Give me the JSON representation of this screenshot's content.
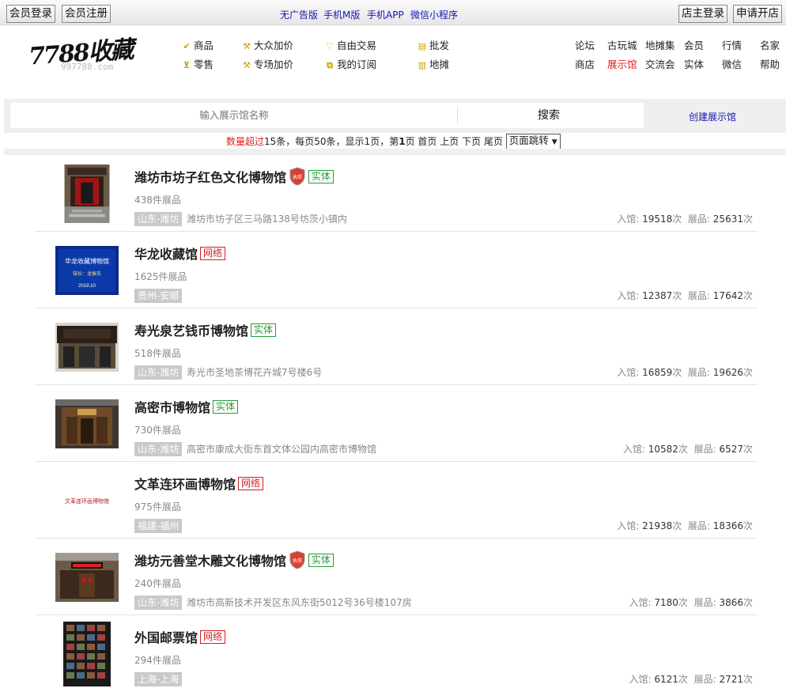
{
  "topbar": {
    "login": "会员登录",
    "register": "会员注册",
    "links": [
      "无广告版",
      "手机M版",
      "手机APP",
      "微信小程序"
    ],
    "shop_login": "店主登录",
    "open_shop": "申请开店"
  },
  "logo": {
    "main": "7788收藏",
    "sub": "997788.com"
  },
  "nav": {
    "categories": [
      {
        "icon": "check-coin",
        "label": "商品"
      },
      {
        "icon": "hammer",
        "label": "大众加价"
      },
      {
        "icon": "heart-hands",
        "label": "自由交易"
      },
      {
        "icon": "box",
        "label": "批发"
      },
      {
        "icon": "cart",
        "label": "零售"
      },
      {
        "icon": "hammer-2",
        "label": "专场加价"
      },
      {
        "icon": "bookmark",
        "label": "我的订阅"
      },
      {
        "icon": "grid",
        "label": "地摊"
      }
    ],
    "right_links_row1": [
      "论坛",
      "古玩城",
      "地摊集",
      "会员",
      "行情",
      "名家"
    ],
    "right_links_row2": [
      "商店",
      "展示馆",
      "交流会",
      "实体",
      "微信",
      "帮助"
    ],
    "active": "展示馆"
  },
  "search": {
    "placeholder": "输入展示馆名称",
    "button": "搜索",
    "create": "创建展示馆"
  },
  "pager": {
    "prefix": "数量超过",
    "total_text": "15条，每页50条，显示1页，第",
    "current": "1",
    "page_unit": "页",
    "first": "首页",
    "prev": "上页",
    "next": "下页",
    "last": "尾页",
    "jump": "页面跳转"
  },
  "items": [
    {
      "title": "潍坊市坊子红色文化博物馆",
      "badge": true,
      "tag": "实体",
      "tag_color": "green",
      "count": "438件展品",
      "region": "山东-潍坊",
      "address": "潍坊市坊子区三马路138号坊茨小镇内",
      "visits_label": "入馆:",
      "visits": "19518",
      "visits_unit": "次",
      "exhibits_label": "展品:",
      "exhibits": "25631",
      "exhibits_unit": "次"
    },
    {
      "title": "华龙收藏馆",
      "badge": false,
      "tag": "网络",
      "tag_color": "red",
      "count": "1625件展品",
      "region": "贵州-安顺",
      "address": "",
      "visits_label": "入馆:",
      "visits": "12387",
      "visits_unit": "次",
      "exhibits_label": "展品:",
      "exhibits": "17642",
      "exhibits_unit": "次"
    },
    {
      "title": "寿光泉艺钱币博物馆",
      "badge": false,
      "tag": "实体",
      "tag_color": "green",
      "count": "518件展品",
      "region": "山东-潍坊",
      "address": "寿光市圣地茶博花卉城7号楼6号",
      "visits_label": "入馆:",
      "visits": "16859",
      "visits_unit": "次",
      "exhibits_label": "展品:",
      "exhibits": "19626",
      "exhibits_unit": "次"
    },
    {
      "title": "高密市博物馆",
      "badge": false,
      "tag": "实体",
      "tag_color": "green",
      "count": "730件展品",
      "region": "山东-潍坊",
      "address": "高密市康成大街东首文体公园内高密市博物馆",
      "visits_label": "入馆:",
      "visits": "10582",
      "visits_unit": "次",
      "exhibits_label": "展品:",
      "exhibits": "6527",
      "exhibits_unit": "次"
    },
    {
      "title": "文革连环画博物馆",
      "badge": false,
      "tag": "网络",
      "tag_color": "red",
      "count": "975件展品",
      "region": "福建-福州",
      "address": "",
      "visits_label": "入馆:",
      "visits": "21938",
      "visits_unit": "次",
      "exhibits_label": "展品:",
      "exhibits": "18366",
      "exhibits_unit": "次"
    },
    {
      "title": "潍坊元善堂木雕文化博物馆",
      "badge": true,
      "tag": "实体",
      "tag_color": "green",
      "count": "240件展品",
      "region": "山东-潍坊",
      "address": "潍坊市高新技术开发区东风东街5012号36号楼107房",
      "visits_label": "入馆:",
      "visits": "7180",
      "visits_unit": "次",
      "exhibits_label": "展品:",
      "exhibits": "3866",
      "exhibits_unit": "次"
    },
    {
      "title": "外国邮票馆",
      "badge": false,
      "tag": "网络",
      "tag_color": "red",
      "count": "294件展品",
      "region": "上海-上海",
      "address": "",
      "visits_label": "入馆:",
      "visits": "6121",
      "visits_unit": "次",
      "exhibits_label": "展品:",
      "exhibits": "2721",
      "exhibits_unit": "次"
    }
  ],
  "thumb_texts": {
    "item1_line1": "华龙收藏博物馆",
    "item1_line2": "馆长：龙振东",
    "item1_line3": "2019.10",
    "item4": "文革连环画博物馆"
  },
  "badge_text": "执照"
}
